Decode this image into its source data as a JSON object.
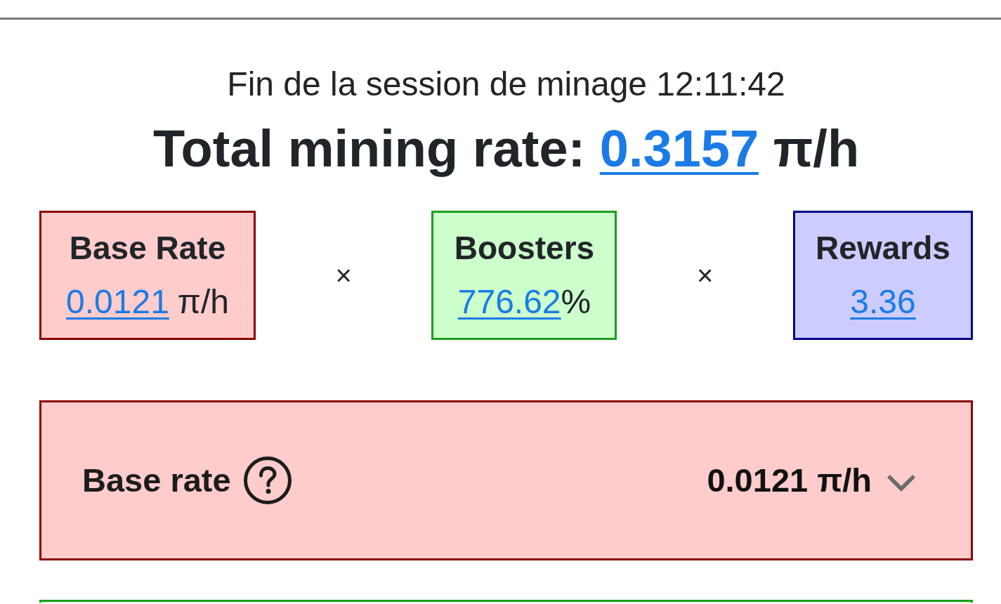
{
  "session_end": "Fin de la session de minage 12:11:42",
  "total": {
    "label": "Total mining rate:",
    "value": "0.3157",
    "unit": "π/h"
  },
  "factors": [
    {
      "kind": "base",
      "title": "Base Rate",
      "value": "0.0121",
      "unit": "π/h"
    },
    {
      "kind": "boosters",
      "title": "Boosters",
      "value": "776.62",
      "unit": "%"
    },
    {
      "kind": "rewards",
      "title": "Rewards",
      "value": "3.36"
    }
  ],
  "operators": [
    "×",
    "×"
  ],
  "panels": [
    {
      "kind": "base",
      "label": "Base rate",
      "value": "0.0121 π/h",
      "expanded": false
    },
    {
      "kind": "boosters"
    }
  ]
}
